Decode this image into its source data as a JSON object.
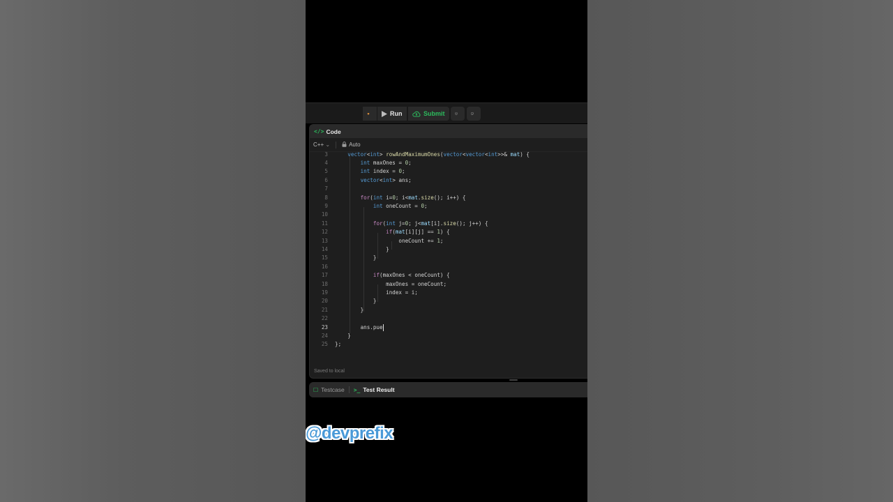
{
  "toolbar": {
    "run_label": "Run",
    "submit_label": "Submit"
  },
  "panel": {
    "title": "Code",
    "language": "C++",
    "mode": "Auto",
    "saved_text": "Saved to local"
  },
  "tabs": [
    {
      "label": "Testcase"
    },
    {
      "label": "Test Result"
    }
  ],
  "editor": {
    "active_line": 23,
    "lines": [
      {
        "n": "3",
        "text": "    vector<int> rowAndMaximumOnes(vector<vector<int>>& mat) {"
      },
      {
        "n": "4",
        "text": "        int maxOnes = 0;"
      },
      {
        "n": "5",
        "text": "        int index = 0;"
      },
      {
        "n": "6",
        "text": "        vector<int> ans;"
      },
      {
        "n": "7",
        "text": ""
      },
      {
        "n": "8",
        "text": "        for(int i=0; i<mat.size(); i++) {"
      },
      {
        "n": "9",
        "text": "            int oneCount = 0;"
      },
      {
        "n": "10",
        "text": ""
      },
      {
        "n": "11",
        "text": "            for(int j=0; j<mat[i].size(); j++) {"
      },
      {
        "n": "12",
        "text": "                if(mat[i][j] == 1) {"
      },
      {
        "n": "13",
        "text": "                    oneCount += 1;"
      },
      {
        "n": "14",
        "text": "                }"
      },
      {
        "n": "15",
        "text": "            }"
      },
      {
        "n": "16",
        "text": ""
      },
      {
        "n": "17",
        "text": "            if(maxOnes < oneCount) {"
      },
      {
        "n": "18",
        "text": "                maxOnes = oneCount;"
      },
      {
        "n": "19",
        "text": "                index = i;"
      },
      {
        "n": "20",
        "text": "            }"
      },
      {
        "n": "21",
        "text": "        }"
      },
      {
        "n": "22",
        "text": ""
      },
      {
        "n": "23",
        "text": "        ans.pue"
      },
      {
        "n": "24",
        "text": "    }"
      },
      {
        "n": "25",
        "text": "};"
      }
    ]
  },
  "watermark": "@devprefix",
  "colors": {
    "accent_green": "#2cbb5d",
    "watermark_blue": "#4a9ad8"
  }
}
